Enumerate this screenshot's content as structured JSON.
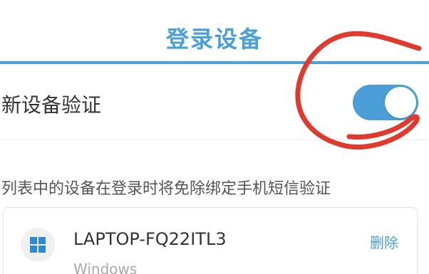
{
  "header": {
    "title": "登录设备"
  },
  "settings": {
    "new_device_verification_label": "新设备验证",
    "new_device_verification_enabled": true
  },
  "description": "列表中的设备在登录时将免除绑定手机短信验证",
  "devices": [
    {
      "name": "LAPTOP-FQ22ITL3",
      "os": "Windows",
      "action_label": "删除",
      "icon": "windows-icon"
    }
  ],
  "colors": {
    "accent": "#4a9fd8",
    "annotation": "#e03a2f"
  }
}
